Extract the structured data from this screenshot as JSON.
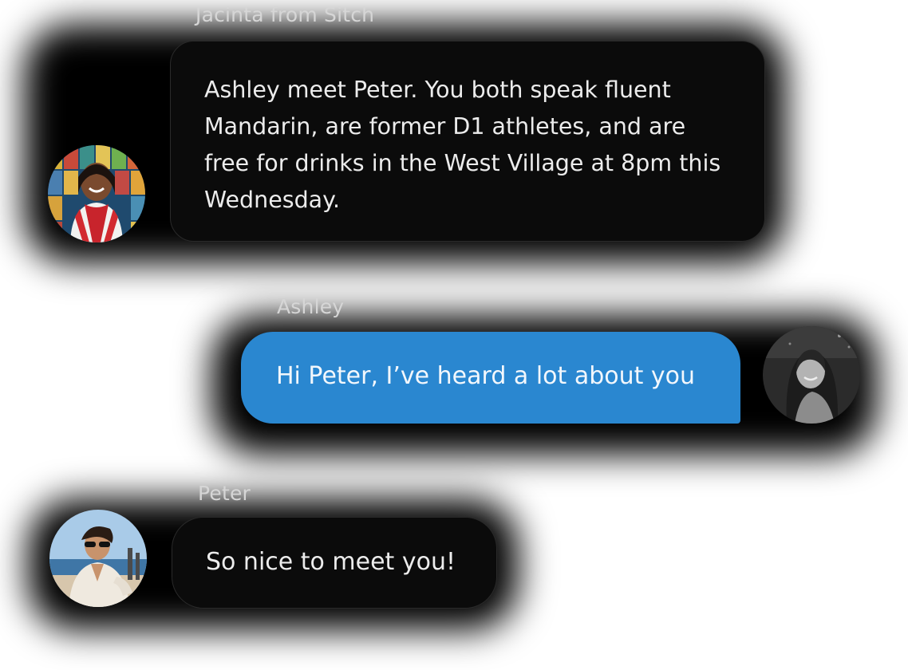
{
  "messages": [
    {
      "sender": "Jacinta from Sitch",
      "text": "Ashley meet Peter. You both speak fluent Mandarin, are former D1 athletes, and are free for drinks in the West Village at 8pm this Wednesday.",
      "avatar_icon": "avatar-photo-jacinta"
    },
    {
      "sender": "Ashley",
      "text": "Hi Peter, I’ve heard a lot about you",
      "avatar_icon": "avatar-photo-ashley",
      "bubble_color": "#2a87d0"
    },
    {
      "sender": "Peter",
      "text": "So nice to meet you!",
      "avatar_icon": "avatar-photo-peter"
    }
  ]
}
